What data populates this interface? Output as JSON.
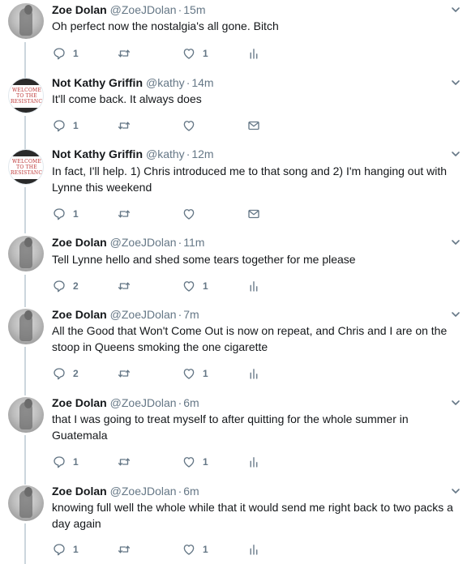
{
  "tweets": [
    {
      "author": "Zoe Dolan",
      "handle": "@ZoeJDolan",
      "time": "15m",
      "text": "Oh perfect now the nostalgia's all gone. Bitch",
      "replies": "1",
      "likes": "1",
      "extra_icon": "analytics-icon",
      "avatar": "zoe"
    },
    {
      "author": "Not Kathy Griffin",
      "handle": "@kathy",
      "time": "14m",
      "text": "It'll come back. It always does",
      "replies": "1",
      "likes": "",
      "extra_icon": "message-icon",
      "avatar": "kathy"
    },
    {
      "author": "Not Kathy Griffin",
      "handle": "@kathy",
      "time": "12m",
      "text": "In fact, I'll help. 1) Chris introduced me to that song and 2) I'm hanging out with Lynne this weekend",
      "replies": "1",
      "likes": "",
      "extra_icon": "message-icon",
      "avatar": "kathy"
    },
    {
      "author": "Zoe Dolan",
      "handle": "@ZoeJDolan",
      "time": "11m",
      "text": "Tell Lynne hello and shed some tears together for me please",
      "replies": "2",
      "likes": "1",
      "extra_icon": "analytics-icon",
      "avatar": "zoe"
    },
    {
      "author": "Zoe Dolan",
      "handle": "@ZoeJDolan",
      "time": "7m",
      "text": "All the Good that Won't Come Out is now on repeat, and Chris and I are on the stoop in Queens smoking the one cigarette",
      "replies": "2",
      "likes": "1",
      "extra_icon": "analytics-icon",
      "avatar": "zoe"
    },
    {
      "author": "Zoe Dolan",
      "handle": "@ZoeJDolan",
      "time": "6m",
      "text": "that I was going to treat myself to after quitting for the whole summer in Guatemala",
      "replies": "1",
      "likes": "1",
      "extra_icon": "analytics-icon",
      "avatar": "zoe"
    },
    {
      "author": "Zoe Dolan",
      "handle": "@ZoeJDolan",
      "time": "6m",
      "text": "knowing full well the whole while that it would send me right back to two packs a day again",
      "replies": "1",
      "likes": "1",
      "extra_icon": "analytics-icon",
      "avatar": "zoe"
    }
  ],
  "kathy_avatar_sign": "WELCOME TO THE RESISTANCE",
  "colors": {
    "text": "#14171a",
    "muted": "#657786",
    "thread_line": "#ccd6dd"
  }
}
